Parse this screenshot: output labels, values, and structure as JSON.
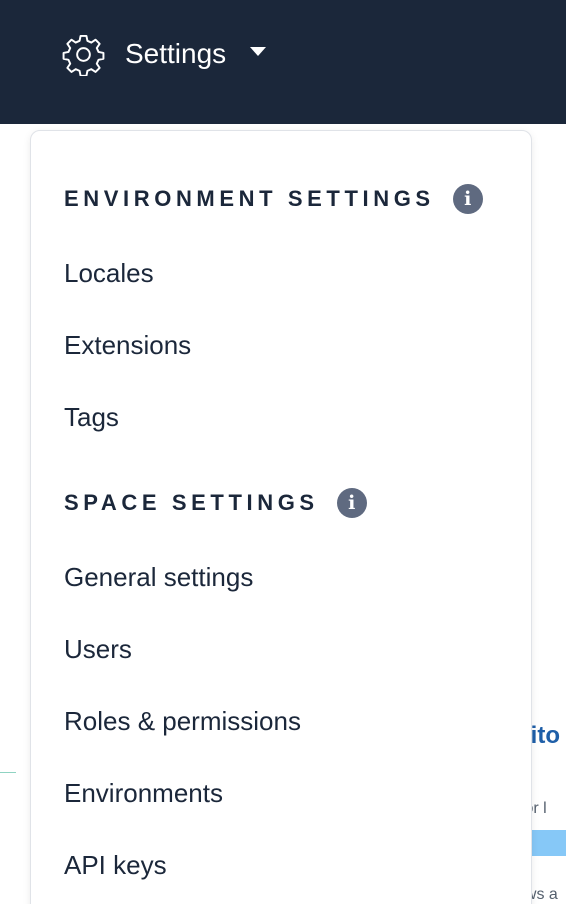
{
  "topbar": {
    "settings_label": "Settings",
    "settings_icon": "gear-icon",
    "caret_icon": "caret-down-icon",
    "background_color": "#1b273a"
  },
  "dropdown": {
    "sections": [
      {
        "title": "ENVIRONMENT SETTINGS",
        "info_icon": "info-icon",
        "info_glyph": "i",
        "items": [
          "Locales",
          "Extensions",
          "Tags"
        ]
      },
      {
        "title": "SPACE SETTINGS",
        "info_icon": "info-icon",
        "info_glyph": "i",
        "items": [
          "General settings",
          "Users",
          "Roles & permissions",
          "Environments",
          "API keys"
        ]
      }
    ]
  },
  "background": {
    "title_fragment": "dito",
    "sub_fragment": "for l",
    "bottom_fragment": "ews a"
  }
}
